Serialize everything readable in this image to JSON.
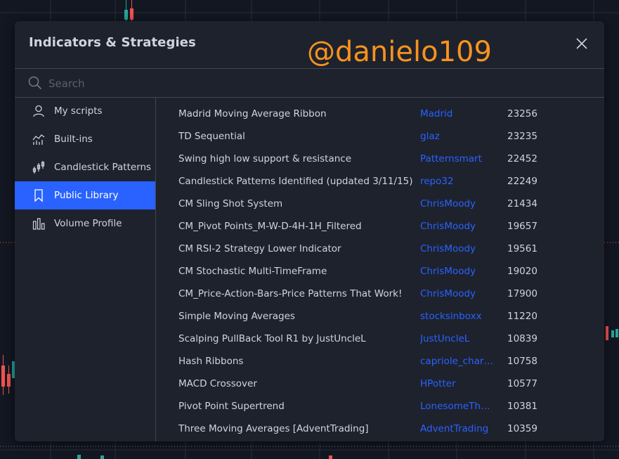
{
  "dialog": {
    "title": "Indicators & Strategies",
    "watermark": "@danielo109",
    "close_icon": "close-icon"
  },
  "search": {
    "placeholder": "Search",
    "value": "",
    "icon": "search-icon"
  },
  "sidebar": {
    "items": [
      {
        "label": "My scripts",
        "icon": "user-icon",
        "active": false
      },
      {
        "label": "Built-ins",
        "icon": "chart-line-icon",
        "active": false
      },
      {
        "label": "Candlestick Patterns",
        "icon": "candlestick-icon",
        "active": false
      },
      {
        "label": "Public Library",
        "icon": "bookmark-icon",
        "active": true
      },
      {
        "label": "Volume Profile",
        "icon": "volume-profile-icon",
        "active": false
      }
    ]
  },
  "scripts": [
    {
      "name": "Madrid Moving Average Ribbon",
      "author": "Madrid",
      "likes": "23256"
    },
    {
      "name": "TD Sequential",
      "author": "glaz",
      "likes": "23235"
    },
    {
      "name": "Swing high low support & resistance",
      "author": "Patternsmart",
      "likes": "22452"
    },
    {
      "name": "Candlestick Patterns Identified (updated 3/11/15)",
      "author": "repo32",
      "likes": "22249"
    },
    {
      "name": "CM Sling Shot System",
      "author": "ChrisMoody",
      "likes": "21434"
    },
    {
      "name": "CM_Pivot Points_M-W-D-4H-1H_Filtered",
      "author": "ChrisMoody",
      "likes": "19657"
    },
    {
      "name": "CM RSI-2 Strategy Lower Indicator",
      "author": "ChrisMoody",
      "likes": "19561"
    },
    {
      "name": "CM Stochastic Multi-TimeFrame",
      "author": "ChrisMoody",
      "likes": "19020"
    },
    {
      "name": "CM_Price-Action-Bars-Price Patterns That Work!",
      "author": "ChrisMoody",
      "likes": "17900"
    },
    {
      "name": "Simple Moving Averages",
      "author": "stocksinboxx",
      "likes": "11220"
    },
    {
      "name": "Scalping PullBack Tool R1 by JustUncleL",
      "author": "JustUncleL",
      "likes": "10839"
    },
    {
      "name": "Hash Ribbons",
      "author": "capriole_charl...",
      "likes": "10758"
    },
    {
      "name": "MACD Crossover",
      "author": "HPotter",
      "likes": "10577"
    },
    {
      "name": "Pivot Point Supertrend",
      "author": "LonesomeThe...",
      "likes": "10381"
    },
    {
      "name": "Three Moving Averages [AdventTrading]",
      "author": "AdventTrading",
      "likes": "10359"
    }
  ],
  "colors": {
    "background": "#131722",
    "panel": "#1e222d",
    "accent": "#2962ff",
    "watermark": "#f7931e",
    "candle_up": "#26a69a",
    "candle_down": "#ef5350"
  }
}
